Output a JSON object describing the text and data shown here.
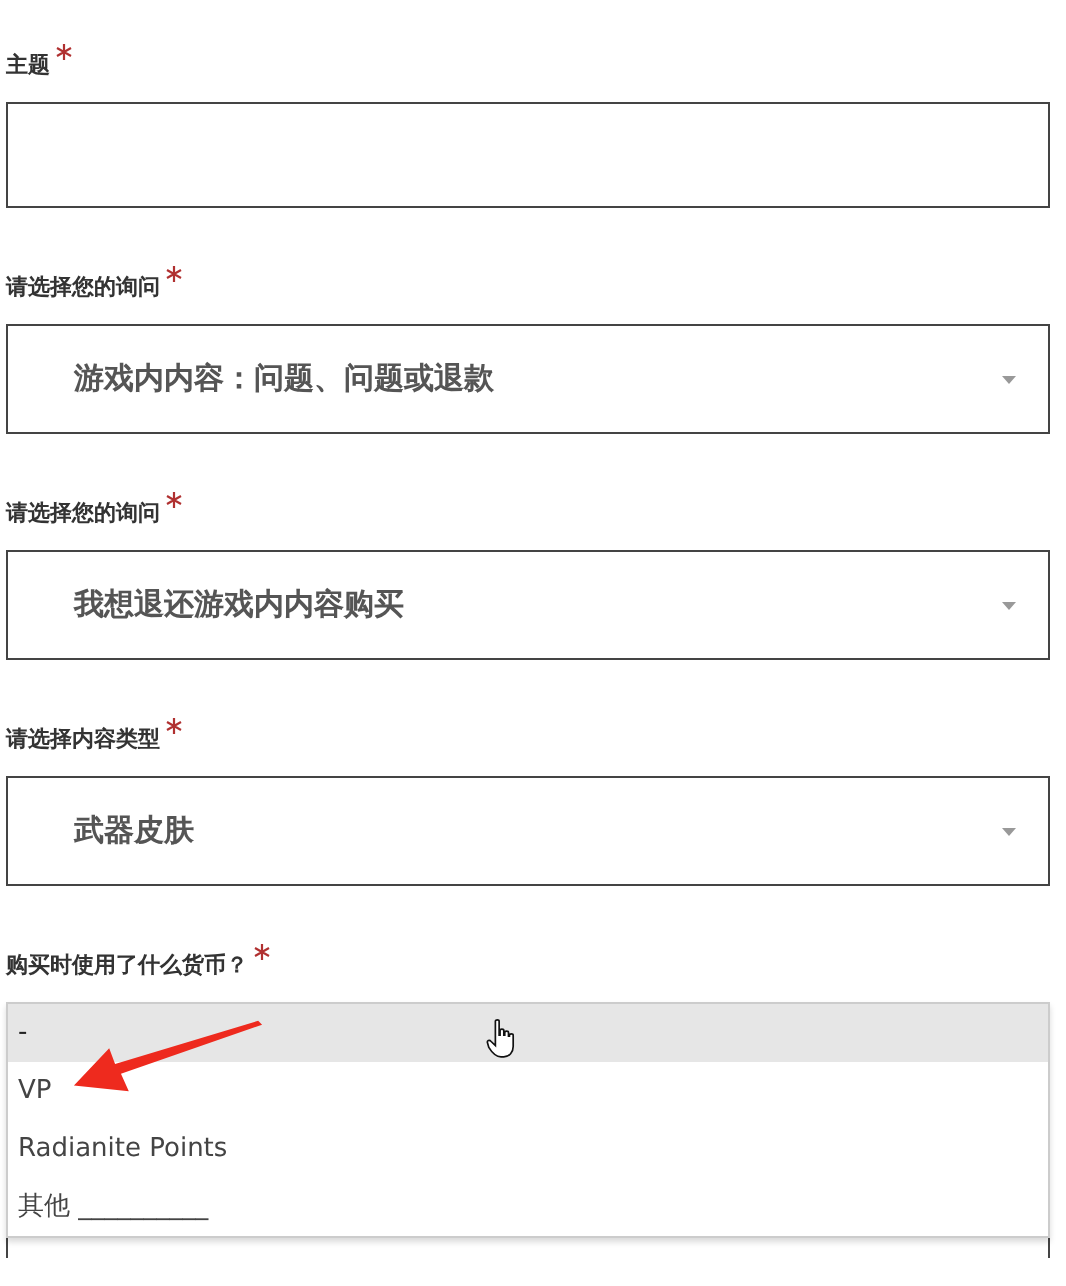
{
  "fields": [
    {
      "label": "主题",
      "required": true,
      "kind": "text"
    },
    {
      "label": "请选择您的询问",
      "required": true,
      "kind": "select",
      "value": "游戏内内容：问题、问题或退款"
    },
    {
      "label": "请选择您的询问",
      "required": true,
      "kind": "select",
      "value": "我想退还游戏内内容购买"
    },
    {
      "label": "请选择内容类型",
      "required": true,
      "kind": "select",
      "value": "武器皮肤"
    },
    {
      "label": "购买时使用了什么货币？",
      "required": true,
      "kind": "open-list",
      "options": [
        {
          "label": "-",
          "selected": true
        },
        {
          "label": "VP",
          "selected": false
        },
        {
          "label": "Radianite Points",
          "selected": false
        },
        {
          "label": "其他 __________",
          "selected": false
        }
      ]
    }
  ]
}
